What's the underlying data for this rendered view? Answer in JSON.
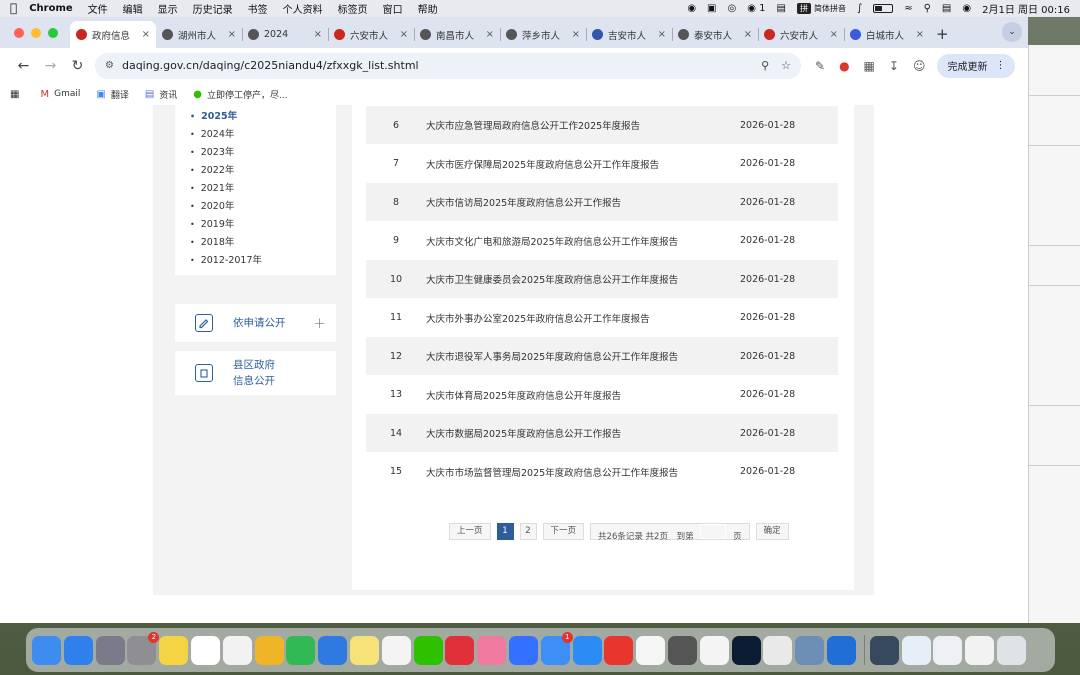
{
  "menubar": {
    "app_name": "Chrome",
    "items": [
      "文件",
      "编辑",
      "显示",
      "历史记录",
      "书签",
      "个人资料",
      "标签页",
      "窗口",
      "帮助"
    ],
    "status_wechat_count": "1",
    "input_method": "简体拼音",
    "input_badge": "拼",
    "datetime": "2月1日 周日  00:16"
  },
  "tabs": [
    {
      "title": "政府信息",
      "icon_color": "#c8281f",
      "active": true
    },
    {
      "title": "湖州市人",
      "icon_color": "#555555"
    },
    {
      "title": "2024",
      "icon_color": "#555555"
    },
    {
      "title": "六安市人",
      "icon_color": "#c8281f"
    },
    {
      "title": "南昌市人",
      "icon_color": "#555555"
    },
    {
      "title": "萍乡市人",
      "icon_color": "#555555"
    },
    {
      "title": "吉安市人",
      "icon_color": "#3355aa"
    },
    {
      "title": "泰安市人",
      "icon_color": "#555555"
    },
    {
      "title": "六安市人",
      "icon_color": "#c8281f"
    },
    {
      "title": "白城市人",
      "icon_color": "#3b5bd9"
    }
  ],
  "toolbar": {
    "url": "daqing.gov.cn/daqing/c2025niandu4/zfxxgk_list.shtml",
    "update_label": "完成更新"
  },
  "bookmarks": [
    {
      "label": "Gmail",
      "icon": "gmail-icon"
    },
    {
      "label": "翻译",
      "icon": "translate-icon"
    },
    {
      "label": "资讯",
      "icon": "news-icon"
    },
    {
      "label": "立即停工停产，尽...",
      "icon": "wechat-icon"
    }
  ],
  "sidebar": {
    "years": [
      "2025年",
      "2024年",
      "2023年",
      "2022年",
      "2021年",
      "2020年",
      "2019年",
      "2018年",
      "2012-2017年"
    ],
    "active_year": "2025年",
    "apply_label": "依申请公开",
    "county_label_line1": "县区政府",
    "county_label_line2": "信息公开"
  },
  "list": {
    "rows": [
      {
        "num": "6",
        "title": "大庆市应急管理局政府信息公开工作2025年度报告",
        "date": "2026-01-28"
      },
      {
        "num": "7",
        "title": "大庆市医疗保障局2025年度政府信息公开工作年度报告",
        "date": "2026-01-28"
      },
      {
        "num": "8",
        "title": "大庆市信访局2025年度政府信息公开工作报告",
        "date": "2026-01-28"
      },
      {
        "num": "9",
        "title": "大庆市文化广电和旅游局2025年政府信息公开工作年度报告",
        "date": "2026-01-28"
      },
      {
        "num": "10",
        "title": "大庆市卫生健康委员会2025年度政府信息公开工作年度报告",
        "date": "2026-01-28"
      },
      {
        "num": "11",
        "title": "大庆市外事办公室2025年政府信息公开工作年度报告",
        "date": "2026-01-28"
      },
      {
        "num": "12",
        "title": "大庆市退役军人事务局2025年度政府信息公开工作年度报告",
        "date": "2026-01-28"
      },
      {
        "num": "13",
        "title": "大庆市体育局2025年度政府信息公开年度报告",
        "date": "2026-01-28"
      },
      {
        "num": "14",
        "title": "大庆市数据局2025年度政府信息公开工作报告",
        "date": "2026-01-28"
      },
      {
        "num": "15",
        "title": "大庆市市场监督管理局2025年度政府信息公开工作年度报告",
        "date": "2026-01-28"
      }
    ]
  },
  "pager": {
    "prev": "上一页",
    "page1": "1",
    "page2": "2",
    "next": "下一页",
    "summary": "共26条记录 共2页",
    "goto": "到第",
    "page_unit": "页",
    "confirm": "确定"
  },
  "dock": {
    "apps": [
      {
        "name": "finder-icon",
        "color": "#3d8cf0"
      },
      {
        "name": "safari-icon",
        "color": "#2f80ed"
      },
      {
        "name": "launchpad-icon",
        "color": "#7a7a8a"
      },
      {
        "name": "system-settings-icon",
        "color": "#8e8e93",
        "badge": "2"
      },
      {
        "name": "notes-icon",
        "color": "#f5d443"
      },
      {
        "name": "freeform-icon",
        "color": "#ffffff"
      },
      {
        "name": "textedit-icon",
        "color": "#f2f2f2"
      },
      {
        "name": "pages-icon",
        "color": "#f0b429"
      },
      {
        "name": "numbers-icon",
        "color": "#30b955"
      },
      {
        "name": "keynote-icon",
        "color": "#2e7ae0"
      },
      {
        "name": "stickies-icon",
        "color": "#f7e27a"
      },
      {
        "name": "qq-icon",
        "color": "#f4f4f4"
      },
      {
        "name": "wechat-icon",
        "color": "#2dc100"
      },
      {
        "name": "netease-music-icon",
        "color": "#e0303a"
      },
      {
        "name": "bilibili-icon",
        "color": "#f07aa0"
      },
      {
        "name": "lark-icon",
        "color": "#3370ff"
      },
      {
        "name": "baidu-netdisk-icon",
        "color": "#3e8ef7",
        "badge": "1"
      },
      {
        "name": "mail-icon",
        "color": "#2a8cf4"
      },
      {
        "name": "wps-icon",
        "color": "#e8362f"
      },
      {
        "name": "alipay-icon",
        "color": "#f5f5f5"
      },
      {
        "name": "calculator-icon",
        "color": "#555555"
      },
      {
        "name": "chrome-icon",
        "color": "#f4f4f4"
      },
      {
        "name": "photoshop-icon",
        "color": "#0b1c33"
      },
      {
        "name": "documents-icon",
        "color": "#e9e9e9"
      },
      {
        "name": "preview-icon",
        "color": "#6d8fb5"
      },
      {
        "name": "xcode-icon",
        "color": "#1f6fd6"
      },
      {
        "name": "quicktime-icon",
        "color": "#374a5d"
      },
      {
        "name": "recent-window-1-icon",
        "color": "#e6eef8"
      },
      {
        "name": "recent-window-2-icon",
        "color": "#eef0f3"
      },
      {
        "name": "recent-window-3-icon",
        "color": "#f2f2f2"
      },
      {
        "name": "trash-icon",
        "color": "#dfe3e8"
      }
    ]
  },
  "colors": {
    "accent": "#2d5d9b",
    "row_shade": "#f2f2f2",
    "page_gray": "#f3f3f3"
  }
}
